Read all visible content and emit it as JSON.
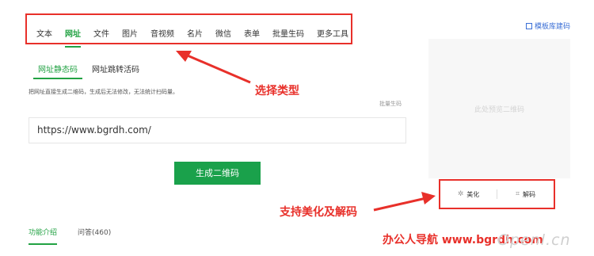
{
  "top_tabs": [
    "文本",
    "网址",
    "文件",
    "图片",
    "音视频",
    "名片",
    "微信",
    "表单",
    "批量生码",
    "更多工具"
  ],
  "template_link": "模板库建码",
  "sub_tabs": [
    "网址静态码",
    "网址跳转活码"
  ],
  "description": "把网址直接生成二维码，生成后无法修改，无法统计扫码量。",
  "batch_label": "批量生码",
  "url_value": "https://www.bgrdh.com/",
  "generate_button": "生成二维码",
  "preview_text": "此处预览二维码",
  "actions": {
    "beautify": "美化",
    "decode": "解码"
  },
  "annotations": {
    "select_type": "选择类型",
    "support": "支持美化及解码"
  },
  "bottom_tabs": [
    "功能介绍",
    "问答(460)"
  ],
  "watermark": "办公人导航 www.bgrdh.com",
  "watermark2": "Openl.cn",
  "colors": {
    "accent": "#22a243",
    "button": "#1aa14b",
    "annotation": "#e8302a",
    "link": "#3b6fd6"
  }
}
